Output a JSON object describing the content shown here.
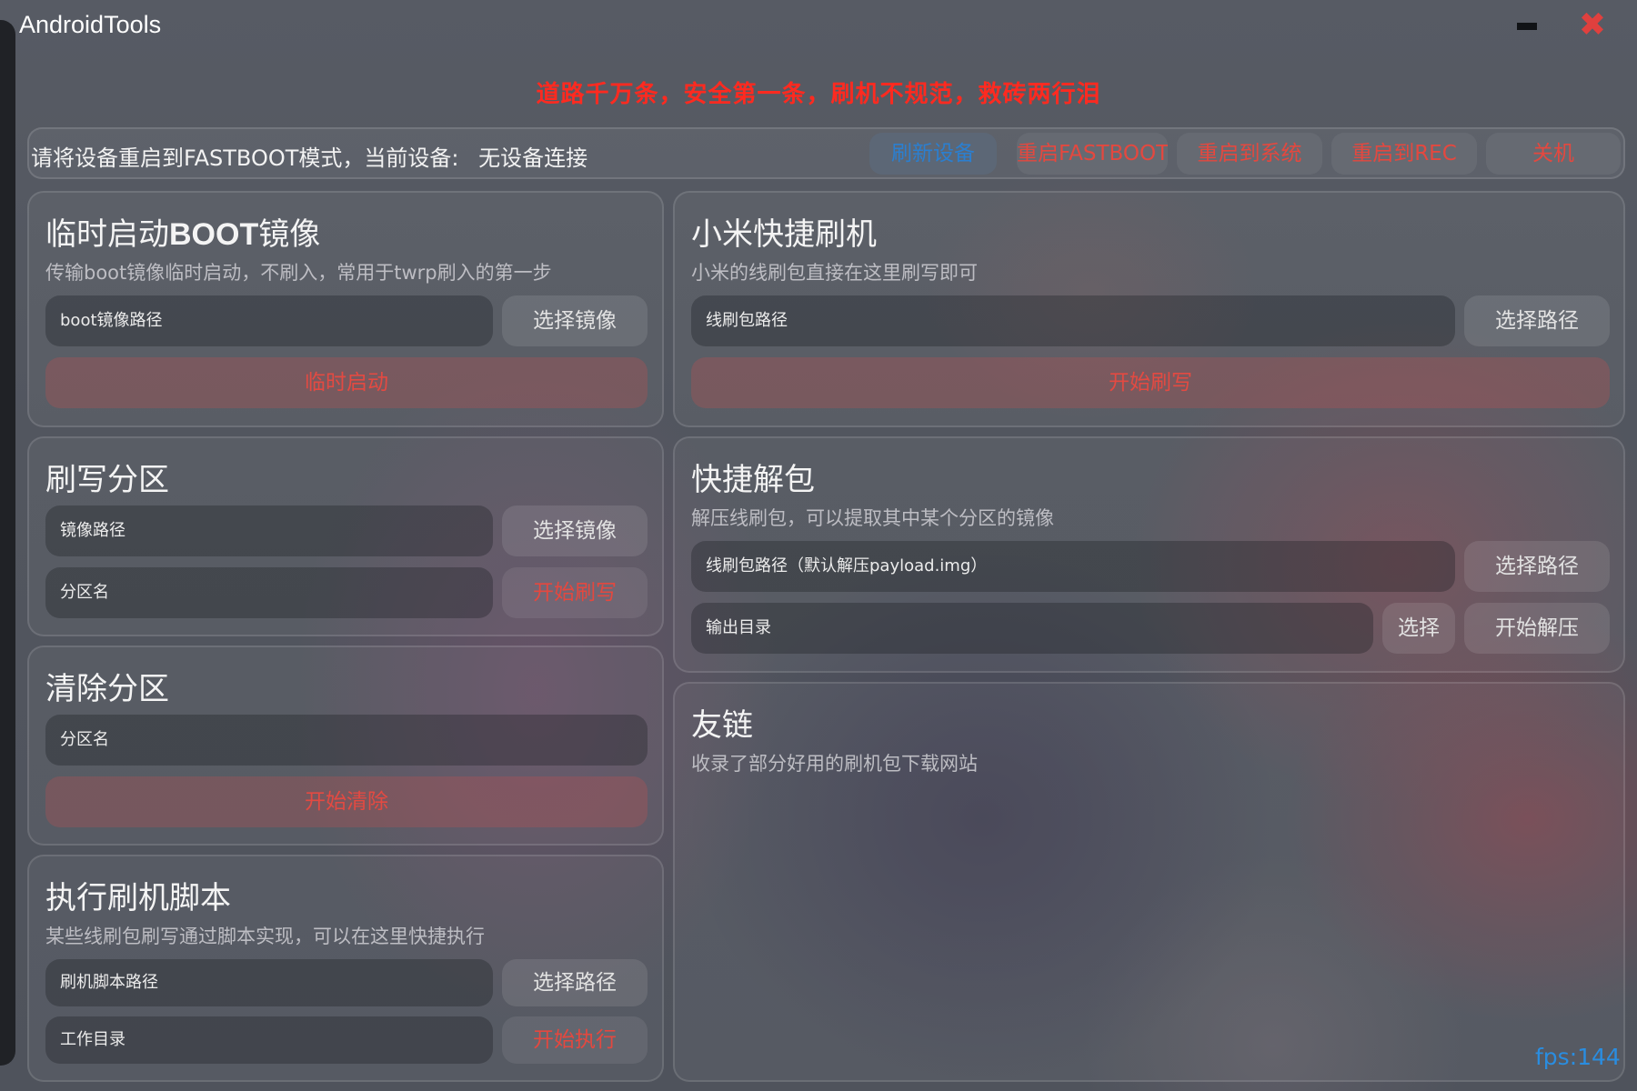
{
  "window": {
    "title": "AndroidTools",
    "motto": "道路千万条，安全第一条，刷机不规范，救砖两行泪"
  },
  "device_bar": {
    "status_label": "请将设备重启到FASTBOOT模式，当前设备:",
    "status_value": "无设备连接",
    "refresh": "刷新设备",
    "reboot_fastboot": "重启FASTBOOT",
    "reboot_system": "重启到系统",
    "reboot_rec": "重启到REC",
    "power_off": "关机"
  },
  "boot": {
    "title_prefix": "临时启动",
    "title_bold": "BOOT",
    "title_suffix": "镜像",
    "desc": "传输boot镜像临时启动，不刷入，常用于twrp刷入的第一步",
    "path_placeholder": "boot镜像路径",
    "select": "选择镜像",
    "start": "临时启动"
  },
  "flash_partition": {
    "title": "刷写分区",
    "image_placeholder": "镜像路径",
    "select": "选择镜像",
    "partition_placeholder": "分区名",
    "start": "开始刷写"
  },
  "clear_partition": {
    "title": "清除分区",
    "partition_placeholder": "分区名",
    "start": "开始清除"
  },
  "script": {
    "title": "执行刷机脚本",
    "desc": "某些线刷包刷写通过脚本实现，可以在这里快捷执行",
    "path_placeholder": "刷机脚本路径",
    "select": "选择路径",
    "workdir_placeholder": "工作目录",
    "start": "开始执行"
  },
  "xiaomi": {
    "title": "小米快捷刷机",
    "desc": "小米的线刷包直接在这里刷写即可",
    "path_placeholder": "线刷包路径",
    "select": "选择路径",
    "start": "开始刷写"
  },
  "unpack": {
    "title": "快捷解包",
    "desc": "解压线刷包，可以提取其中某个分区的镜像",
    "path_placeholder": "线刷包路径（默认解压payload.img）",
    "select": "选择路径",
    "output_placeholder": "输出目录",
    "select_output": "选择",
    "start": "开始解压"
  },
  "links": {
    "title": "友链",
    "desc": "收录了部分好用的刷机包下载网站"
  },
  "fps": "fps:144",
  "colors": {
    "accent_red": "#e4483f",
    "motto_red": "#ff2a20",
    "refresh_blue": "#2b7fd0",
    "fps_blue": "#2a8de0"
  }
}
